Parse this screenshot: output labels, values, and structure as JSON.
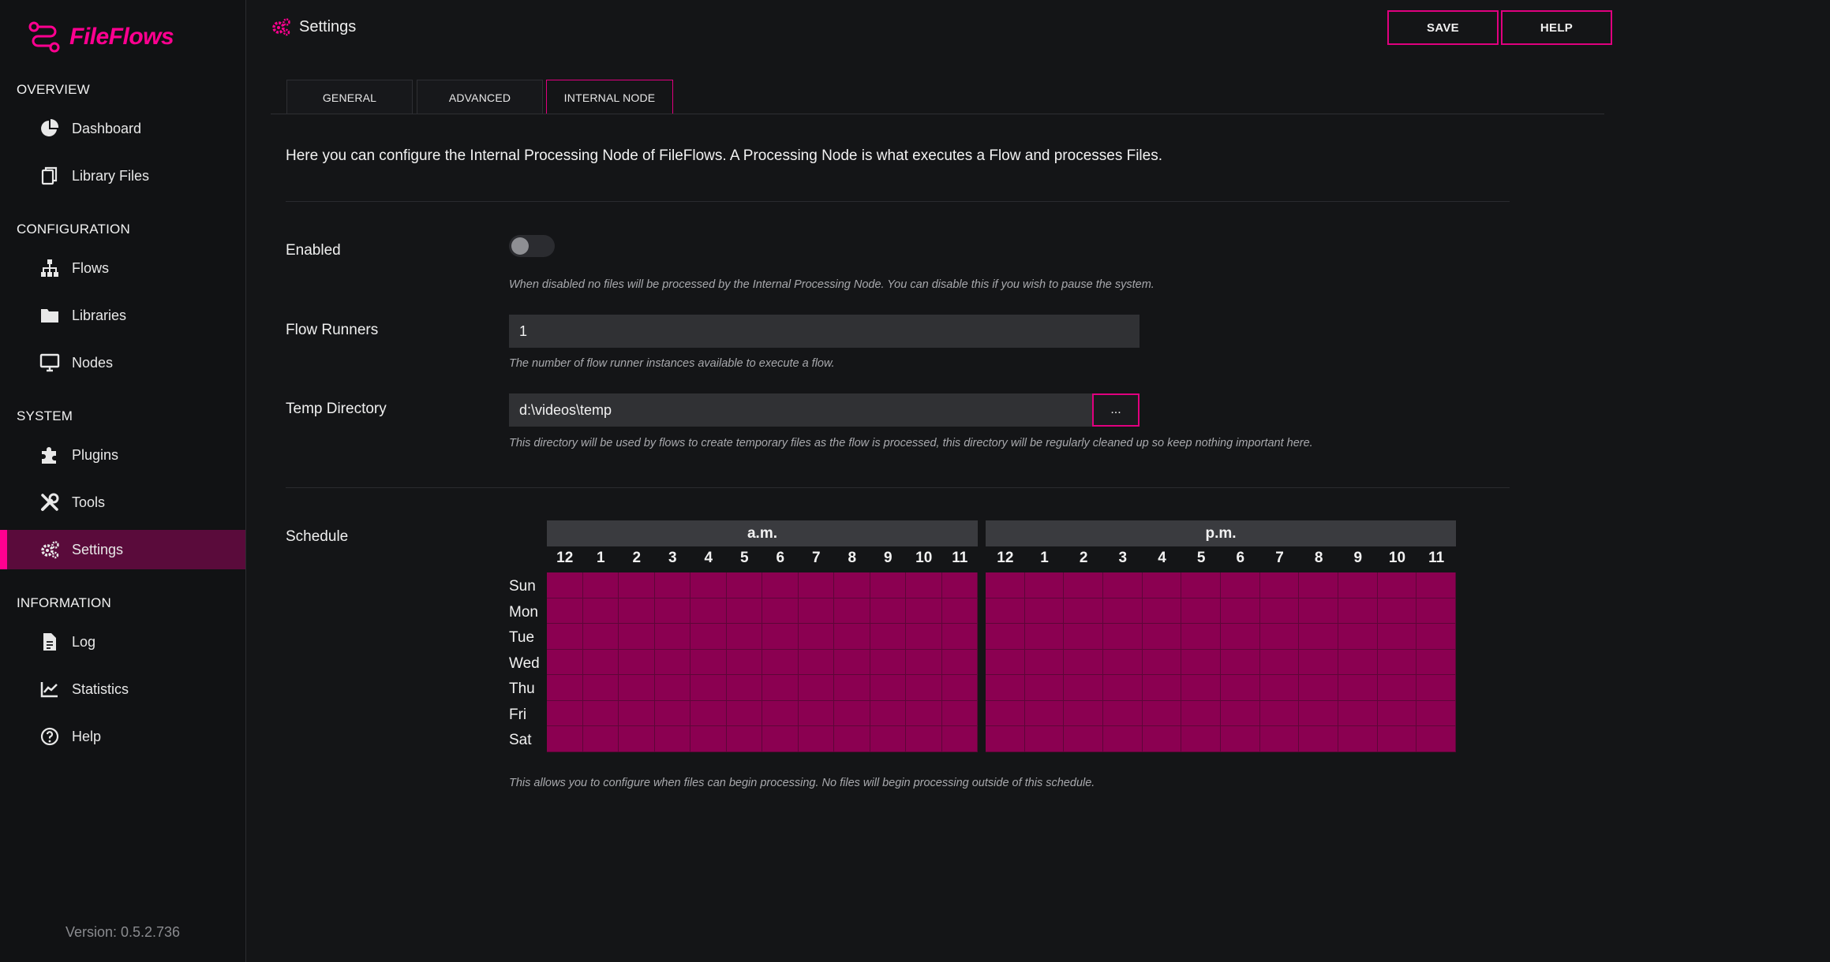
{
  "app": {
    "name": "FileFlows",
    "version": "Version: 0.5.2.736"
  },
  "sidebar": {
    "sections": [
      {
        "label": "OVERVIEW",
        "items": [
          {
            "label": "Dashboard",
            "icon": "pie-chart-icon"
          },
          {
            "label": "Library Files",
            "icon": "files-icon"
          }
        ]
      },
      {
        "label": "CONFIGURATION",
        "items": [
          {
            "label": "Flows",
            "icon": "sitemap-icon"
          },
          {
            "label": "Libraries",
            "icon": "folder-icon"
          },
          {
            "label": "Nodes",
            "icon": "monitor-icon"
          }
        ]
      },
      {
        "label": "SYSTEM",
        "items": [
          {
            "label": "Plugins",
            "icon": "puzzle-icon"
          },
          {
            "label": "Tools",
            "icon": "tools-icon"
          },
          {
            "label": "Settings",
            "icon": "cogs-icon",
            "active": true
          }
        ]
      },
      {
        "label": "INFORMATION",
        "items": [
          {
            "label": "Log",
            "icon": "file-text-icon"
          },
          {
            "label": "Statistics",
            "icon": "chart-line-icon"
          },
          {
            "label": "Help",
            "icon": "question-circle-icon"
          }
        ]
      }
    ]
  },
  "header": {
    "title": "Settings",
    "save_label": "SAVE",
    "help_label": "HELP"
  },
  "tabs": [
    {
      "label": "GENERAL"
    },
    {
      "label": "ADVANCED"
    },
    {
      "label": "INTERNAL NODE",
      "active": true
    }
  ],
  "content": {
    "intro": "Here you can configure the Internal Processing Node of FileFlows.   A Processing Node is what executes a Flow and processes Files.",
    "enabled": {
      "label": "Enabled",
      "value": false,
      "help": "When disabled no files will be processed by the Internal Processing Node.   You can disable this if you wish to pause the system."
    },
    "flow_runners": {
      "label": "Flow Runners",
      "value": "1",
      "help": "The number of flow runner instances available to execute a flow."
    },
    "temp_directory": {
      "label": "Temp Directory",
      "value": "d:\\videos\\temp",
      "browse_label": "...",
      "help": "This directory will be used by flows to create temporary files as the flow is processed, this directory will be regularly cleaned up so keep nothing important here."
    },
    "schedule": {
      "label": "Schedule",
      "am_label": "a.m.",
      "pm_label": "p.m.",
      "hours": [
        "12",
        "1",
        "2",
        "3",
        "4",
        "5",
        "6",
        "7",
        "8",
        "9",
        "10",
        "11"
      ],
      "days": [
        "Sun",
        "Mon",
        "Tue",
        "Wed",
        "Thu",
        "Fri",
        "Sat"
      ],
      "all_selected": true,
      "selected_color": "#8b0051",
      "help": "This allows you to configure when files can begin processing.   No files will begin processing outside of this schedule."
    }
  },
  "colors": {
    "accent": "#ff0090",
    "active_nav_bg": "#5a0b3b",
    "background": "#141517"
  }
}
